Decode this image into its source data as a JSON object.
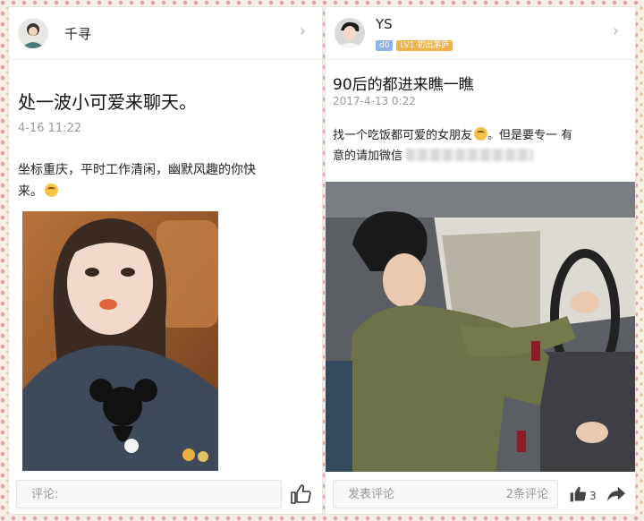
{
  "left_post": {
    "user": {
      "name": "千寻"
    },
    "title": "处一波小可爱来聊天。",
    "time": "4-16 11:22",
    "body_line1": "坐标重庆，平时工作清闲，幽默风趣的你快",
    "body_line2": "来。",
    "emoji": "smile-emoji",
    "comment_placeholder": "评论:",
    "like_icon": "thumbs-up-icon"
  },
  "right_post": {
    "user": {
      "name": "YS",
      "badge_id": "d0",
      "badge_level": "LV1 初出茅庐"
    },
    "title": "90后的都进来瞧一瞧",
    "time": "2017-4-13 0:22",
    "body_line1": "找一个吃饭都可爱的女朋友",
    "body_line1_rest": "。但是要专一   有",
    "body_line2": "意的请加微信",
    "emoji": "sad-emoji",
    "comment_placeholder": "发表评论",
    "comment_count": "2条评论",
    "like_count": "3",
    "like_icon": "thumbs-up-icon",
    "share_icon": "share-arrow-icon"
  },
  "colors": {
    "badge_blue": "#8fb3e6",
    "badge_orange": "#f0b24a"
  }
}
